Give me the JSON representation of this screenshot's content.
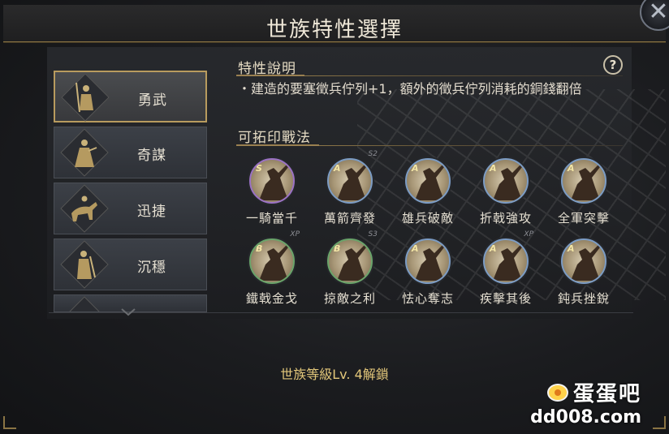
{
  "header": {
    "title": "世族特性選擇",
    "close_icon": "close-icon"
  },
  "traits": [
    {
      "label": "勇武",
      "icon": "spearman-icon",
      "active": true
    },
    {
      "label": "奇謀",
      "icon": "strategist-icon",
      "active": false
    },
    {
      "label": "迅捷",
      "icon": "cavalry-icon",
      "active": false
    },
    {
      "label": "沉穩",
      "icon": "general-icon",
      "active": false
    }
  ],
  "description": {
    "heading": "特性說明",
    "help_icon": "?",
    "text": "・建造的要塞徵兵佇列+1，額外的徵兵佇列消耗的銅錢翻倍"
  },
  "tactics": {
    "heading": "可拓印戰法",
    "items": [
      {
        "name": "一騎當千",
        "grade": "S",
        "tag": ""
      },
      {
        "name": "萬箭齊發",
        "grade": "A",
        "tag": "S2"
      },
      {
        "name": "雄兵破敵",
        "grade": "A",
        "tag": ""
      },
      {
        "name": "折戟強攻",
        "grade": "A",
        "tag": ""
      },
      {
        "name": "全軍突擊",
        "grade": "A",
        "tag": ""
      },
      {
        "name": "鐵戟金戈",
        "grade": "B",
        "tag": "XP"
      },
      {
        "name": "掠敵之利",
        "grade": "B",
        "tag": "S3"
      },
      {
        "name": "怯心奪志",
        "grade": "A",
        "tag": ""
      },
      {
        "name": "疾擊其後",
        "grade": "A",
        "tag": "XP"
      },
      {
        "name": "鈍兵挫銳",
        "grade": "A",
        "tag": ""
      }
    ]
  },
  "unlock_text": "世族等級Lv. 4解鎖",
  "watermark": {
    "name": "蛋蛋吧",
    "url": "dd008.com"
  },
  "colors": {
    "accent_gold": "#b89b5e",
    "unlock_gold": "#e3c77a",
    "ring_s": "#9b72c4",
    "ring_a": "#7c9cc4",
    "ring_b": "#6aa46a"
  }
}
